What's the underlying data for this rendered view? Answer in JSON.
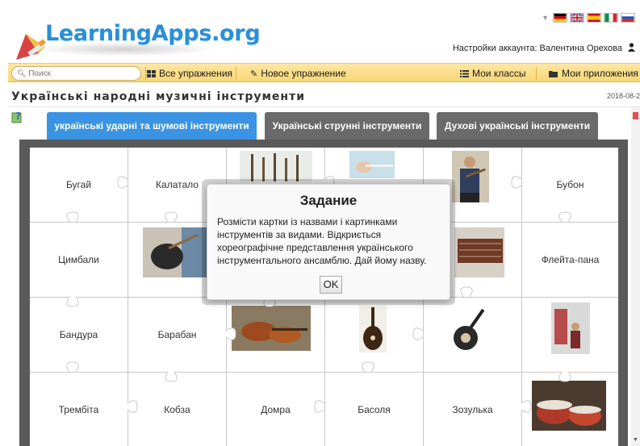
{
  "header": {
    "logo": "LearningApps.org",
    "account_label": "Настройки аккаунта: Валентина Орехова",
    "flags": [
      "de-flag-icon",
      "uk-flag-icon",
      "es-flag-icon",
      "it-flag-icon",
      "ru-flag-icon"
    ]
  },
  "toolbar": {
    "search_placeholder": "Поиск",
    "all_exercises": "Все упражнения",
    "new_exercise": "Новое упражнение",
    "my_classes": "Мои классы",
    "my_apps": "Мои приложения"
  },
  "page": {
    "title": "Українські народні музичні інструменти",
    "date": "2018-08-2"
  },
  "tabs": [
    {
      "label": "українські ударні та шумові інструменти",
      "active": true
    },
    {
      "label": "Українські струнні інструменти",
      "active": false
    },
    {
      "label": "Духові українські інструменти",
      "active": false
    }
  ],
  "grid": {
    "rows": [
      [
        "Бугай",
        "Калатало",
        "[image]",
        "[image]",
        "[image]",
        "Бубон"
      ],
      [
        "Цимбали",
        "[image]",
        "",
        "",
        "[image]",
        "Флейта-пана"
      ],
      [
        "Бандура",
        "Барабан",
        "[image]",
        "[image]",
        "[image]",
        "[image]"
      ],
      [
        "Трембіта",
        "Кобза",
        "Домра",
        "Басоля",
        "Зозулька",
        "[image]"
      ]
    ]
  },
  "modal": {
    "title": "Задание",
    "text": "Розмісти картки із назвами і картинками інструментів за видами. Відкриється хореографічне представлення українського інструментального ансамблю. Дай йому назву.",
    "ok_label": "OK"
  },
  "colors": {
    "accent_blue": "#3a94e3",
    "tab_gray": "#6a6a6a",
    "toolbar_yellow": "#f8d775",
    "board_gray": "#5a5a5a"
  }
}
